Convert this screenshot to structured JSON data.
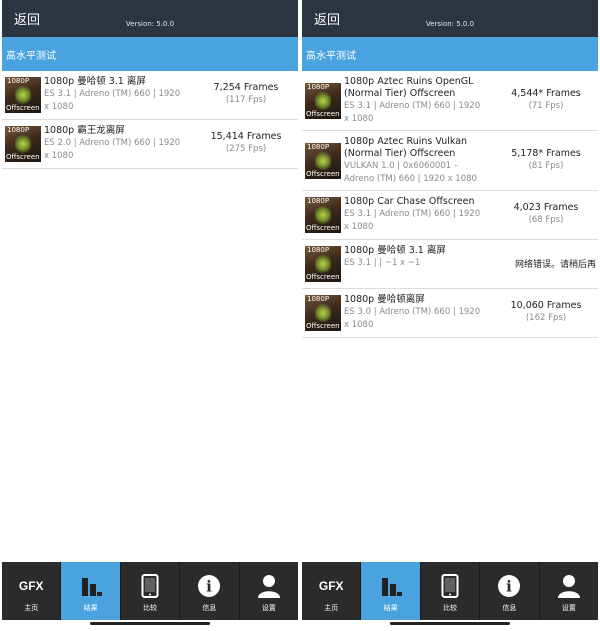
{
  "panels": [
    {
      "back_label": "返回",
      "version": "Version: 5.0.0",
      "section_title": "高水平测试",
      "tests": [
        {
          "thumb_top": "1080P",
          "thumb_bottom": "Offscreen",
          "name_lines": [
            "1080p 曼哈顿 3.1 离屏"
          ],
          "detail_lines": [
            "ES 3.1 | Adreno (TM) 660 | 1920",
            "x 1080"
          ],
          "frames": "7,254 Frames",
          "fps": "(117 Fps)"
        },
        {
          "thumb_top": "1080P",
          "thumb_bottom": "Offscreen",
          "name_lines": [
            "1080p 霸王龙离屏"
          ],
          "detail_lines": [
            "ES 2.0 | Adreno (TM) 660 | 1920",
            "x 1080"
          ],
          "frames": "15,414 Frames",
          "fps": "(275 Fps)"
        }
      ]
    },
    {
      "back_label": "返回",
      "version": "Version: 5.0.0",
      "section_title": "高水平测试",
      "tests": [
        {
          "thumb_top": "1080P",
          "thumb_bottom": "Offscreen",
          "name_lines": [
            "1080p Aztec Ruins OpenGL",
            "(Normal Tier) Offscreen"
          ],
          "detail_lines": [
            "ES 3.1 | Adreno (TM) 660 | 1920",
            "x 1080"
          ],
          "frames": "4,544* Frames",
          "fps": "(71 Fps)"
        },
        {
          "thumb_top": "1080P",
          "thumb_bottom": "Offscreen",
          "name_lines": [
            "1080p Aztec Ruins Vulkan",
            "(Normal Tier) Offscreen"
          ],
          "detail_lines": [
            "VULKAN 1.0 | 0x6060001 –",
            "Adreno (TM) 660 | 1920 x 1080"
          ],
          "frames": "5,178* Frames",
          "fps": "(81 Fps)"
        },
        {
          "thumb_top": "1080P",
          "thumb_bottom": "Offscreen",
          "name_lines": [
            "1080p Car Chase Offscreen"
          ],
          "detail_lines": [
            "ES 3.1 | Adreno (TM) 660 | 1920",
            "x 1080"
          ],
          "frames": "4,023 Frames",
          "fps": "(68 Fps)"
        },
        {
          "thumb_top": "1080P",
          "thumb_bottom": "Offscreen",
          "name_lines": [
            "1080p 曼哈顿 3.1 离屏"
          ],
          "detail_lines": [
            "ES 3.1 |  | ~1 x ~1"
          ],
          "error": "网络错误。请稍后再"
        },
        {
          "thumb_top": "1080P",
          "thumb_bottom": "Offscreen",
          "name_lines": [
            "1080p 曼哈顿离屏"
          ],
          "detail_lines": [
            "ES 3.0 | Adreno (TM) 660 | 1920",
            "x 1080"
          ],
          "frames": "10,060 Frames",
          "fps": "(162 Fps)"
        }
      ]
    }
  ],
  "tabs": [
    {
      "label": "主页",
      "icon": "gfx-logo-icon",
      "icon_text": "GFX",
      "active": false
    },
    {
      "label": "结果",
      "icon": "bar-chart-icon",
      "active": true
    },
    {
      "label": "比较",
      "icon": "phone-icon",
      "active": false
    },
    {
      "label": "信息",
      "icon": "info-icon",
      "icon_text": "i",
      "active": false
    },
    {
      "label": "设置",
      "icon": "user-icon",
      "active": false
    }
  ],
  "colors": {
    "topbar": "#2b3440",
    "accent": "#4aa3df",
    "tabbar": "#2b2b2b"
  }
}
